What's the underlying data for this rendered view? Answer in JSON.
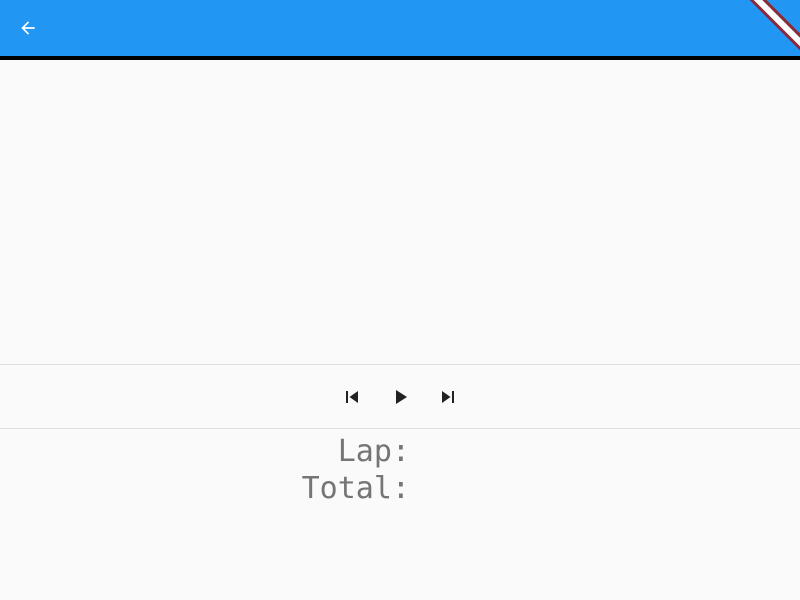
{
  "appbar": {
    "background": "#2196f3",
    "back_icon": "arrow-back-icon"
  },
  "controls": {
    "previous_icon": "skip-previous-icon",
    "play_icon": "play-icon",
    "next_icon": "skip-next-icon"
  },
  "stats": {
    "lap_label": "Lap:",
    "total_label": "Total:"
  }
}
